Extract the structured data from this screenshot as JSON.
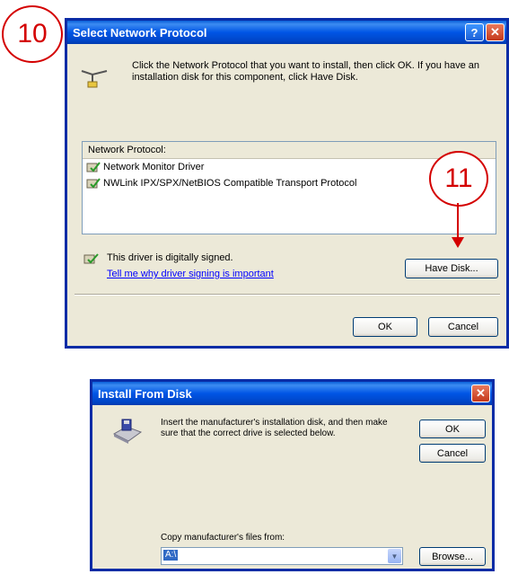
{
  "callouts": {
    "step1": "10",
    "step2": "11"
  },
  "dialog1": {
    "title": "Select Network Protocol",
    "title_buttons": {
      "help": "?",
      "close": "✕"
    },
    "instructions": "Click the Network Protocol that you want to install, then click OK. If you have an installation disk for this component, click Have Disk.",
    "list_header": "Network Protocol:",
    "protocols": [
      "Network Monitor Driver",
      "NWLink IPX/SPX/NetBIOS Compatible Transport Protocol"
    ],
    "signed_text": "This driver is digitally signed.",
    "signing_link": "Tell me why driver signing is important",
    "have_disk_label": "Have Disk...",
    "ok_label": "OK",
    "cancel_label": "Cancel"
  },
  "dialog2": {
    "title": "Install From Disk",
    "title_buttons": {
      "close": "✕"
    },
    "instructions": "Insert the manufacturer's installation disk, and then make sure that the correct drive is selected below.",
    "ok_label": "OK",
    "cancel_label": "Cancel",
    "copy_label": "Copy manufacturer's files from:",
    "path_value": "A:\\",
    "browse_label": "Browse..."
  },
  "colors": {
    "titlebar": "#0055e5",
    "dialog_bg": "#ece9d8",
    "callout": "#d40000",
    "link": "#0000ff"
  },
  "icons": {
    "network_protocol": "network-cable-icon",
    "protocol_item": "protocol-icon",
    "signed": "signed-driver-icon",
    "disk_drive": "floppy-drive-icon",
    "dropdown": "chevron-down-icon"
  }
}
